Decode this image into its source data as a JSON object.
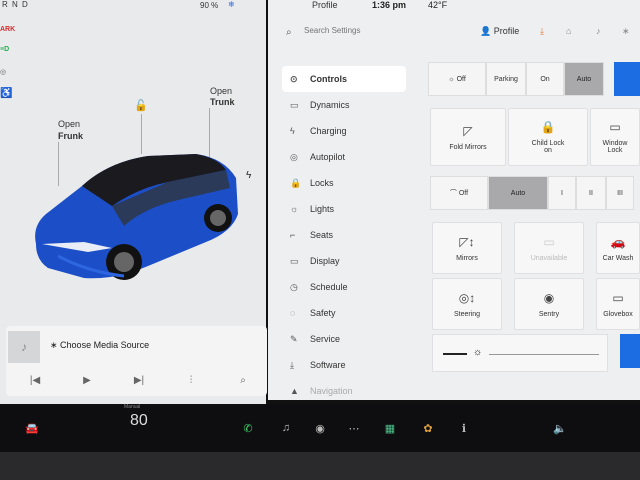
{
  "status": {
    "gear": "R N D",
    "battery": "90 %",
    "snow": "❄",
    "profile": "Profile",
    "time": "1:36 pm",
    "temp": "42°F"
  },
  "telltales": [
    "ARK",
    "≡D",
    "◎",
    "♿"
  ],
  "left": {
    "frunk_line1": "Open",
    "frunk_line2": "Frunk",
    "trunk_line1": "Open",
    "trunk_line2": "Trunk",
    "media_source": "Choose Media Source"
  },
  "search": {
    "placeholder": "Search Settings"
  },
  "profile_label": "Profile",
  "menu": [
    {
      "label": "Controls",
      "icon": "toggle-icon",
      "glyph": "⊙"
    },
    {
      "label": "Dynamics",
      "icon": "car-icon",
      "glyph": "▭"
    },
    {
      "label": "Charging",
      "icon": "bolt-icon",
      "glyph": "ϟ"
    },
    {
      "label": "Autopilot",
      "icon": "steering-icon",
      "glyph": "◎"
    },
    {
      "label": "Locks",
      "icon": "lock-icon",
      "glyph": "🔒"
    },
    {
      "label": "Lights",
      "icon": "sun-icon",
      "glyph": "☼"
    },
    {
      "label": "Seats",
      "icon": "seat-icon",
      "glyph": "⌐"
    },
    {
      "label": "Display",
      "icon": "display-icon",
      "glyph": "▭"
    },
    {
      "label": "Schedule",
      "icon": "clock-icon",
      "glyph": "◷"
    },
    {
      "label": "Safety",
      "icon": "alert-icon",
      "glyph": "◌"
    },
    {
      "label": "Service",
      "icon": "wrench-icon",
      "glyph": "✎"
    },
    {
      "label": "Software",
      "icon": "download-icon",
      "glyph": "⤓"
    },
    {
      "label": "Navigation",
      "icon": "nav-icon",
      "glyph": "▲"
    }
  ],
  "lights": {
    "options": [
      "Off",
      "Parking",
      "On",
      "Auto"
    ],
    "selected": "Auto"
  },
  "cards_row1": [
    {
      "label": "Fold Mirrors",
      "icon": "mirror-icon"
    },
    {
      "label": "Child Lock\non",
      "icon": "child-lock-icon"
    },
    {
      "label": "Window\nLock",
      "icon": "window-lock-icon"
    }
  ],
  "wipers": {
    "off": "Off",
    "auto": "Auto",
    "levels": [
      "I",
      "II",
      "III"
    ]
  },
  "cards_row2": [
    {
      "label": "Mirrors",
      "icon": "mirror-adjust-icon"
    },
    {
      "label": "Unavailable",
      "icon": "display-off-icon"
    },
    {
      "label": "Car Wash",
      "icon": "car-wash-icon"
    }
  ],
  "cards_row3": [
    {
      "label": "Steering",
      "icon": "steering-adjust-icon"
    },
    {
      "label": "Sentry",
      "icon": "sentry-icon"
    },
    {
      "label": "Glovebox",
      "icon": "glovebox-icon"
    }
  ],
  "dock": {
    "speed_label": "Manual",
    "speed": "80"
  },
  "colors": {
    "accent": "#1c6de1",
    "car": "#1c4fc7"
  }
}
